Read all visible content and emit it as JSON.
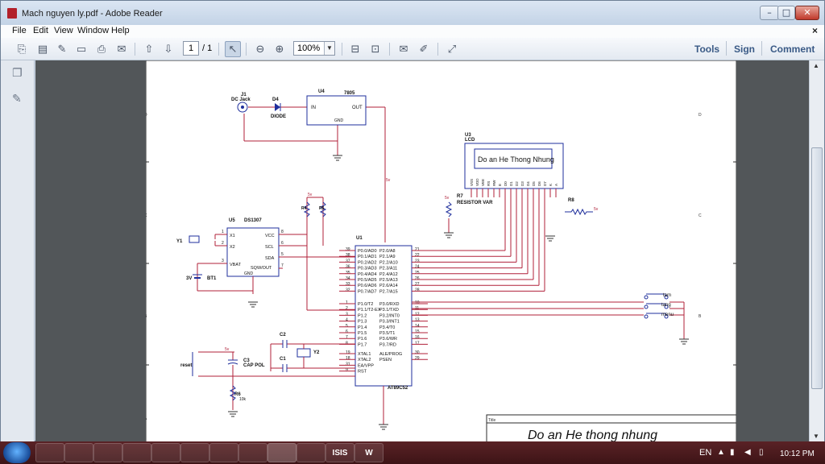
{
  "window": {
    "title": "Mach nguyen ly.pdf - Adobe Reader",
    "controls": {
      "minimize": "–",
      "maximize": "□",
      "close": "✕"
    }
  },
  "menubar": {
    "items": [
      "File",
      "Edit",
      "View",
      "Window",
      "Help"
    ],
    "close": "×"
  },
  "toolbar": {
    "page_current": "1",
    "page_total": "/ 1",
    "zoom": "100%",
    "tools": "Tools",
    "sign": "Sign",
    "comment": "Comment"
  },
  "schematic": {
    "border_rows": [
      "D",
      "C",
      "B",
      "A"
    ],
    "title_label": "Title",
    "title_text": "Do an He thong nhung",
    "lcd_text": "Do an He Thong Nhung",
    "parts": {
      "j1": "J1",
      "j1_name": "DC Jack",
      "d4": "D4",
      "d4_name": "DIODE",
      "u4": "U4",
      "u4_name": "7805",
      "u4_in": "IN",
      "u4_out": "OUT",
      "u4_gnd": "GND",
      "u3": "U3",
      "u3_name": "LCD",
      "r7": "R7",
      "r7_name": "RESISTOR VAR",
      "r8": "R8",
      "u5": "U5",
      "u5_name": "DS1307",
      "y1": "Y1",
      "bt1": "BT1",
      "bt1_v": "3V",
      "r4": "R4",
      "r5": "R5",
      "u1": "U1",
      "u1_name": "AT89C52",
      "c1": "C1",
      "c2": "C2",
      "c3": "C3",
      "c3_name": "CAP POL",
      "y2": "Y2",
      "r6": "R6",
      "r6_val": "10k",
      "reset": "reset",
      "sw_tam": "tam",
      "sw_tang": "tang",
      "sw_menu": "menu",
      "v5": "5v"
    },
    "u5_pins": [
      "X1",
      "X2",
      "VBAT",
      "VCC",
      "SCL",
      "SDA",
      "SQW/OUT",
      "GND"
    ],
    "u5_pin_nums": [
      "1",
      "2",
      "3",
      "8",
      "6",
      "5",
      "7"
    ],
    "lcd_pins": [
      "VSS",
      "VDD",
      "VEE",
      "RS",
      "RW",
      "E",
      "D0",
      "D1",
      "D2",
      "D3",
      "D4",
      "D5",
      "D6",
      "D7",
      "K",
      "A"
    ],
    "u1_p0": [
      "P0.0/AD0",
      "P0.1/AD1",
      "P0.2/AD2",
      "P0.3/AD3",
      "P0.4/AD4",
      "P0.5/AD5",
      "P0.6/AD6",
      "P0.7/AD7"
    ],
    "u1_p0_nums": [
      "39",
      "38",
      "37",
      "36",
      "35",
      "34",
      "33",
      "32"
    ],
    "u1_p1": [
      "P1.0/T2",
      "P1.1/T2-EX",
      "P1.2",
      "P1.3",
      "P1.4",
      "P1.5",
      "P1.6",
      "P1.7"
    ],
    "u1_p1_nums": [
      "1",
      "2",
      "3",
      "4",
      "5",
      "6",
      "7",
      "8"
    ],
    "u1_p2": [
      "P2.0/A8",
      "P2.1/A9",
      "P2.2/A10",
      "P2.3/A11",
      "P2.4/A12",
      "P2.5/A13",
      "P2.6/A14",
      "P2.7/A15"
    ],
    "u1_p2_nums": [
      "21",
      "22",
      "23",
      "24",
      "25",
      "26",
      "27",
      "28"
    ],
    "u1_p3": [
      "P3.0/RXD",
      "P3.1/TXD",
      "P3.2/INT0",
      "P3.3/INT1",
      "P3.4/T0",
      "P3.5/T1",
      "P3.6/WR",
      "P3.7/RD"
    ],
    "u1_p3_nums": [
      "10",
      "11",
      "12",
      "13",
      "14",
      "15",
      "16",
      "17"
    ],
    "u1_left_misc": [
      "XTAL1",
      "XTAL2",
      "EA/VPP",
      "RST"
    ],
    "u1_left_misc_nums": [
      "19",
      "18",
      "31",
      "9"
    ],
    "u1_right_misc": [
      "ALE/PROG",
      "PSEN"
    ],
    "u1_right_misc_nums": [
      "30",
      "29"
    ]
  },
  "taskbar": {
    "apps": [
      "",
      "",
      "",
      "",
      "",
      "",
      "",
      "",
      "",
      "",
      "ISIS",
      "W"
    ],
    "lang": "EN",
    "time": "10:12 PM"
  },
  "colors": {
    "wire": "#b0203a",
    "component": "#1f2f9c",
    "pin": "#8b1a1a",
    "noconnect": "#c02020"
  }
}
